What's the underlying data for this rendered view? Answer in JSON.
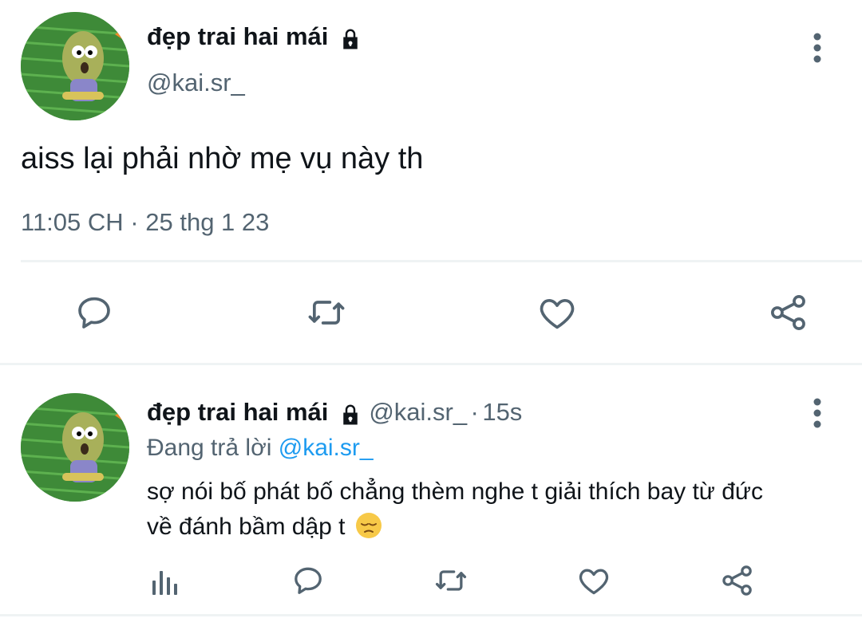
{
  "main_tweet": {
    "display_name": "đẹp trai hai mái",
    "handle": "@kai.sr_",
    "text": "aiss lại phải nhờ mẹ vụ này th",
    "time": "11:05 CH",
    "separator": "·",
    "date": "25 thg 1 23",
    "icons": [
      "more-vertical-icon",
      "reply-icon",
      "retweet-icon",
      "like-icon",
      "share-icon"
    ]
  },
  "reply_tweet": {
    "display_name": "đẹp trai hai mái",
    "handle": "@kai.sr_",
    "separator": "·",
    "age": "15s",
    "replying_prefix": "Đang trả lời",
    "replying_to": "@kai.sr_",
    "text_line1": "sợ nói bố phát bố chẳng thèm nghe t giải thích bay từ đức",
    "text_line2": "về đánh bầm dập t",
    "emoji": "pensive-face",
    "icons": [
      "analytics-icon",
      "reply-icon",
      "retweet-icon",
      "like-icon",
      "share-icon"
    ]
  },
  "colors": {
    "text": "#0f1419",
    "muted": "#536471",
    "link": "#1d9bf0",
    "divider": "#eff3f4",
    "avatar_bg": "#3f8f3a"
  }
}
